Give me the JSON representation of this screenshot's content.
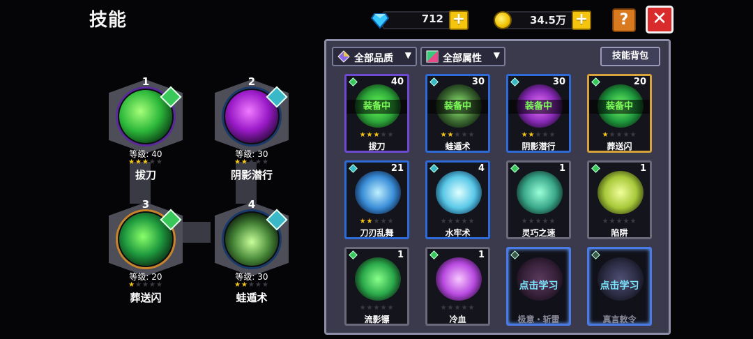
{
  "header": {
    "title": "技能"
  },
  "currency": {
    "gems": {
      "icon": "diamond-icon",
      "value": "712",
      "add_label": "+"
    },
    "gold": {
      "icon": "coin-icon",
      "value": "34.5万",
      "add_label": "+"
    }
  },
  "buttons": {
    "help_label": "?",
    "close_label": "✕"
  },
  "equipped": [
    {
      "slot": "1",
      "level": "等级: 40",
      "stars": 3,
      "name": "拔刀",
      "orb_color": "#39c94a"
    },
    {
      "slot": "2",
      "level": "等级: 30",
      "stars": 2,
      "name": "阴影潜行",
      "orb_color": "#9a22c9"
    },
    {
      "slot": "3",
      "level": "等级: 20",
      "stars": 1,
      "name": "葬送闪",
      "orb_color": "#2fb84a"
    },
    {
      "slot": "4",
      "level": "等级: 30",
      "stars": 2,
      "name": "蛙遁术",
      "orb_color": "#3c8a3a"
    }
  ],
  "filters": {
    "quality_label": "全部品质",
    "attribute_label": "全部属性",
    "bag_label": "技能背包"
  },
  "equipped_tag": "装备中",
  "learn_tag": "点击学习",
  "skills": [
    {
      "name": "拔刀",
      "count": "40",
      "stars": 3,
      "equipped": true,
      "quality": "purple",
      "art_color": "#2ea83a"
    },
    {
      "name": "蛙遁术",
      "count": "30",
      "stars": 2,
      "equipped": true,
      "quality": "blue",
      "art_color": "#3d6a32"
    },
    {
      "name": "阴影潜行",
      "count": "30",
      "stars": 2,
      "equipped": true,
      "quality": "blue",
      "art_color": "#8a2bb8"
    },
    {
      "name": "葬送闪",
      "count": "20",
      "stars": 1,
      "equipped": true,
      "quality": "gold",
      "art_color": "#1f9a3e"
    },
    {
      "name": "刀刃乱舞",
      "count": "21",
      "stars": 2,
      "equipped": false,
      "quality": "blue",
      "art_color": "#3a8ed8"
    },
    {
      "name": "水牢术",
      "count": "4",
      "stars": 0,
      "equipped": false,
      "quality": "blue",
      "art_color": "#5ac8e8"
    },
    {
      "name": "灵巧之速",
      "count": "1",
      "stars": 0,
      "equipped": false,
      "quality": "grey",
      "art_color": "#3aa88a"
    },
    {
      "name": "陷阱",
      "count": "1",
      "stars": 0,
      "equipped": false,
      "quality": "grey",
      "art_color": "#a8c83a"
    },
    {
      "name": "流影镖",
      "count": "1",
      "stars": 0,
      "equipped": false,
      "quality": "grey",
      "art_color": "#2aa84a"
    },
    {
      "name": "冷血",
      "count": "1",
      "stars": 0,
      "equipped": false,
      "quality": "grey",
      "art_color": "#b84ae0"
    },
    {
      "name": "极意・斩雷",
      "count": "",
      "stars": 0,
      "equipped": false,
      "quality": "learn",
      "learnable": true,
      "art_color": "#4a2a4a"
    },
    {
      "name": "真言敕令",
      "count": "",
      "stars": 0,
      "equipped": false,
      "quality": "learn",
      "learnable": true,
      "art_color": "#3a3a5a"
    }
  ]
}
